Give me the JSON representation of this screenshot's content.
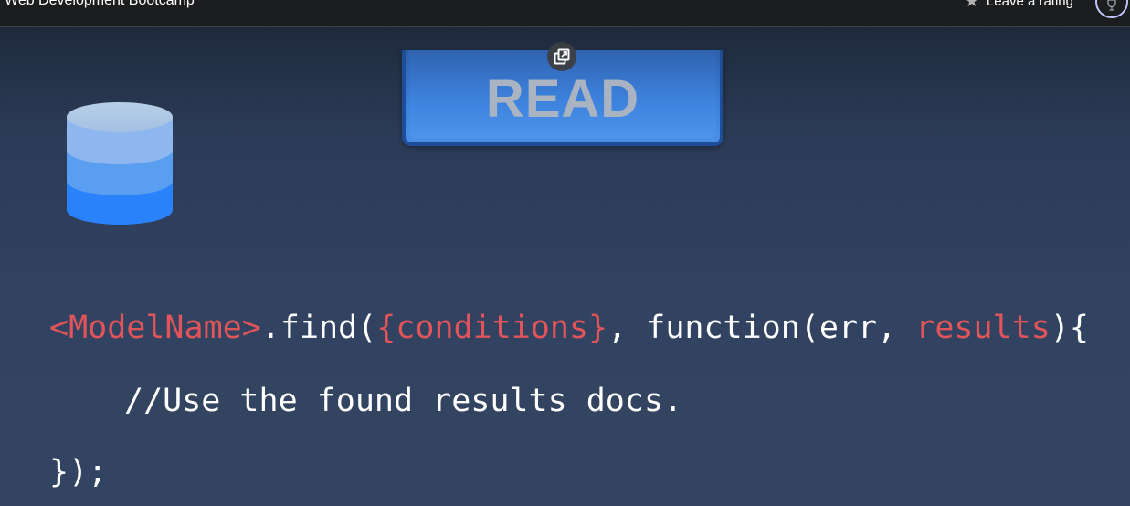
{
  "header": {
    "course_title": "Web Development Bootcamp",
    "rating_label": "Leave a rating",
    "star_icon": "star-icon",
    "progress_icon": "trophy-icon"
  },
  "video": {
    "card_label": "READ",
    "popout_icon": "popout-icon",
    "database_icon": "database-icon",
    "colors": {
      "accent_blue": "#3b7dd8",
      "code_red": "#e0545a",
      "code_white": "#ffffff",
      "background": "#314360"
    },
    "code": {
      "line1": {
        "model": "<ModelName>",
        "find": ".find(",
        "conditions": "{conditions}",
        "middle": ", function(err, ",
        "results": "results",
        "end": "){"
      },
      "line2": "//Use the found results docs.",
      "line3": "});"
    }
  }
}
